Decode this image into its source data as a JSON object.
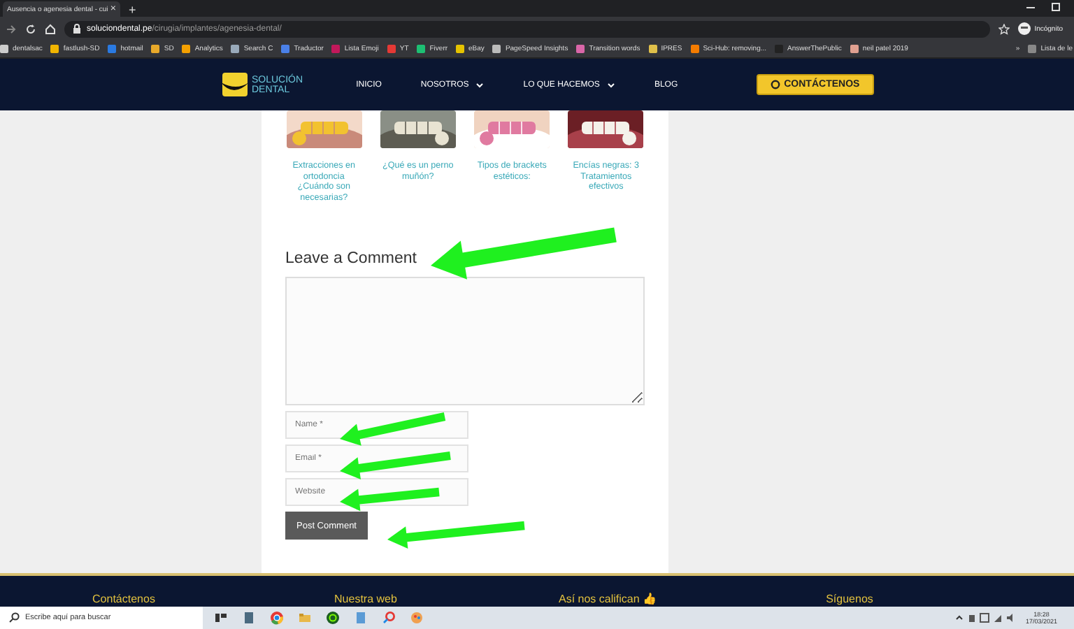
{
  "browser": {
    "tab_title": "Ausencia o agenesia dental - cui",
    "tab_close": "×",
    "new_tab": "+",
    "url_domain": "soluciondental.pe",
    "url_path": "/cirugia/implantes/agenesia-dental/",
    "profile": "Incógnito",
    "bookmarks": [
      "dentalsac",
      "fastlush-SD",
      "hotmail",
      "SD",
      "Analytics",
      "Search C",
      "Traductor",
      "Lista Emoji",
      "YT",
      "Fiverr",
      "eBay",
      "PageSpeed Insights",
      "Transition words",
      "IPRES",
      "Sci-Hub: removing...",
      "AnswerThePublic",
      "neil patel 2019"
    ],
    "more_bookmarks": "»",
    "reading_list": "Lista de le"
  },
  "site_nav": {
    "logo_line_1": "SOLUCIÓN",
    "logo_line_2": "DENTAL",
    "items": [
      {
        "label": "INICIO",
        "dropdown": false
      },
      {
        "label": "NOSOTROS",
        "dropdown": true
      },
      {
        "label": "LO QUE HACEMOS",
        "dropdown": true
      },
      {
        "label": "BLOG",
        "dropdown": false
      }
    ],
    "cta": "CONTÁCTENOS"
  },
  "related_posts": [
    {
      "title": "Extracciones en ortodoncia ¿Cuándo son necesarias?",
      "kind": "picture"
    },
    {
      "title": "¿Qué es un perno muñón?",
      "kind": "picture"
    },
    {
      "title": "Tipos de brackets estéticos:",
      "kind": "picture"
    },
    {
      "title": "Encías negras: 3 Tratamientos efectivos",
      "kind": "picture"
    }
  ],
  "comment_form": {
    "heading": "Leave a Comment",
    "fields": [
      {
        "placeholder": "Name *"
      },
      {
        "placeholder": "Email *"
      },
      {
        "placeholder": "Website"
      }
    ],
    "submit": "Post Comment"
  },
  "annotation_arrows": [
    {
      "kind": "arrow"
    },
    {
      "kind": "arrow"
    },
    {
      "kind": "arrow"
    },
    {
      "kind": "arrow"
    },
    {
      "kind": "arrow"
    }
  ],
  "footer": {
    "headings": [
      "Contáctenos",
      "Nuestra web",
      "Así nos califican 👍",
      "Síguenos"
    ]
  },
  "taskbar": {
    "search_placeholder": "Escribe aquí para buscar",
    "time": "18:28",
    "date": "17/03/2021"
  }
}
